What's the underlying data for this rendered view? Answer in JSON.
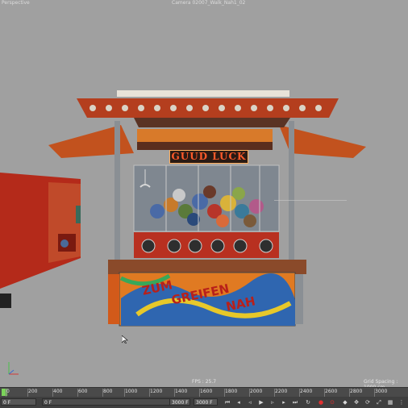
{
  "viewport": {
    "name": "Perspective",
    "camera": "Camera 02007_Walk_Nah1_02",
    "fps_label": "FPS : 25.7",
    "grid_spacing": "Grid Spacing : 1000 cm"
  },
  "scene": {
    "booth_sign": "GUUD LUCK",
    "panel_text_1": "ZUM",
    "panel_text_2": "GREIFEN",
    "panel_text_3": "NAH"
  },
  "timeline": {
    "ticks": [
      "0",
      "200",
      "400",
      "600",
      "800",
      "1000",
      "1200",
      "1400",
      "1600",
      "1800",
      "2000",
      "2200",
      "2400",
      "2600",
      "2800",
      "3000"
    ]
  },
  "transport": {
    "current_frame": "0 F",
    "min_frame": "0 F",
    "max_frame": "3000 F",
    "end_frame": "3000 F"
  },
  "colors": {
    "viewport_bg": "#a0a0a0",
    "booth_orange": "#e2641e",
    "booth_red": "#c0281c",
    "timeline_marker": "#7bd35a"
  }
}
